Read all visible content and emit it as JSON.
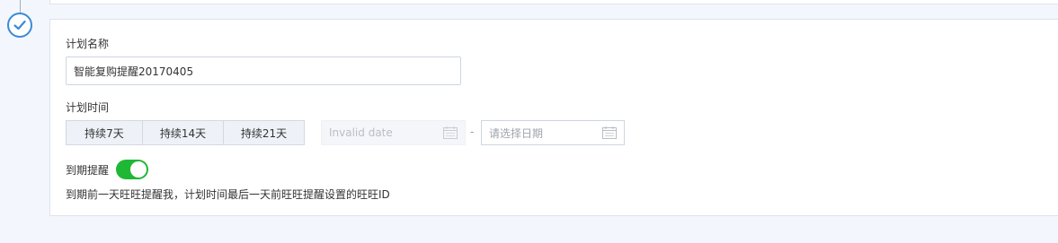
{
  "form": {
    "plan_name_label": "计划名称",
    "plan_name_value": "智能复购提醒20170405",
    "plan_time_label": "计划时间",
    "duration_buttons": [
      "持续7天",
      "持续14天",
      "持续21天"
    ],
    "start_date_value": "Invalid date",
    "date_separator": "-",
    "end_date_placeholder": "请选择日期",
    "reminder_label": "到期提醒",
    "reminder_enabled": true,
    "reminder_description": "到期前一天旺旺提醒我，计划时间最后一天前旺旺提醒设置的旺旺ID"
  },
  "colors": {
    "accent": "#3b8ad8",
    "toggle_on": "#1fb834",
    "background": "#f3f6fc"
  },
  "icons": {
    "step": "check-icon",
    "date": "calendar-icon"
  }
}
